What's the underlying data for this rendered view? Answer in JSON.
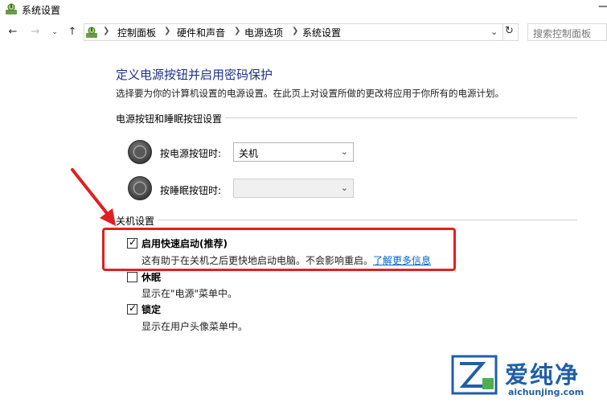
{
  "window": {
    "title": "系统设置",
    "minimize_glyph": "—"
  },
  "address": {
    "back_icon": "back-arrow-icon",
    "crumbs": [
      "控制面板",
      "硬件和声音",
      "电源选项",
      "系统设置"
    ],
    "search_placeholder": "搜索控制面板"
  },
  "page": {
    "title": "定义电源按钮并启用密码保护",
    "description": "选择要为你的计算机设置的电源设置。在此页上对设置所做的更改将应用于你所有的电源计划。"
  },
  "buttons_section": {
    "heading": "电源按钮和睡眠按钮设置",
    "power_button": {
      "label": "按电源按钮时:",
      "value": "关机"
    },
    "sleep_button": {
      "label": "按睡眠按钮时:",
      "value": ""
    }
  },
  "shutdown_section": {
    "heading": "关机设置",
    "items": [
      {
        "label": "启用快速启动(推荐)",
        "checked": true,
        "desc": "这有助于在关机之后更快地启动电脑。不会影响重启。",
        "link": "了解更多信息"
      },
      {
        "label": "休眠",
        "checked": false,
        "desc": "显示在\"电源\"菜单中。"
      },
      {
        "label": "锁定",
        "checked": true,
        "desc": "显示在用户头像菜单中。"
      }
    ]
  },
  "watermark": {
    "brand": "爱纯净",
    "url": "aichunjing.com"
  },
  "colors": {
    "title_blue": "#1e3287",
    "highlight_red": "#e02020",
    "link_blue": "#0066cc"
  }
}
